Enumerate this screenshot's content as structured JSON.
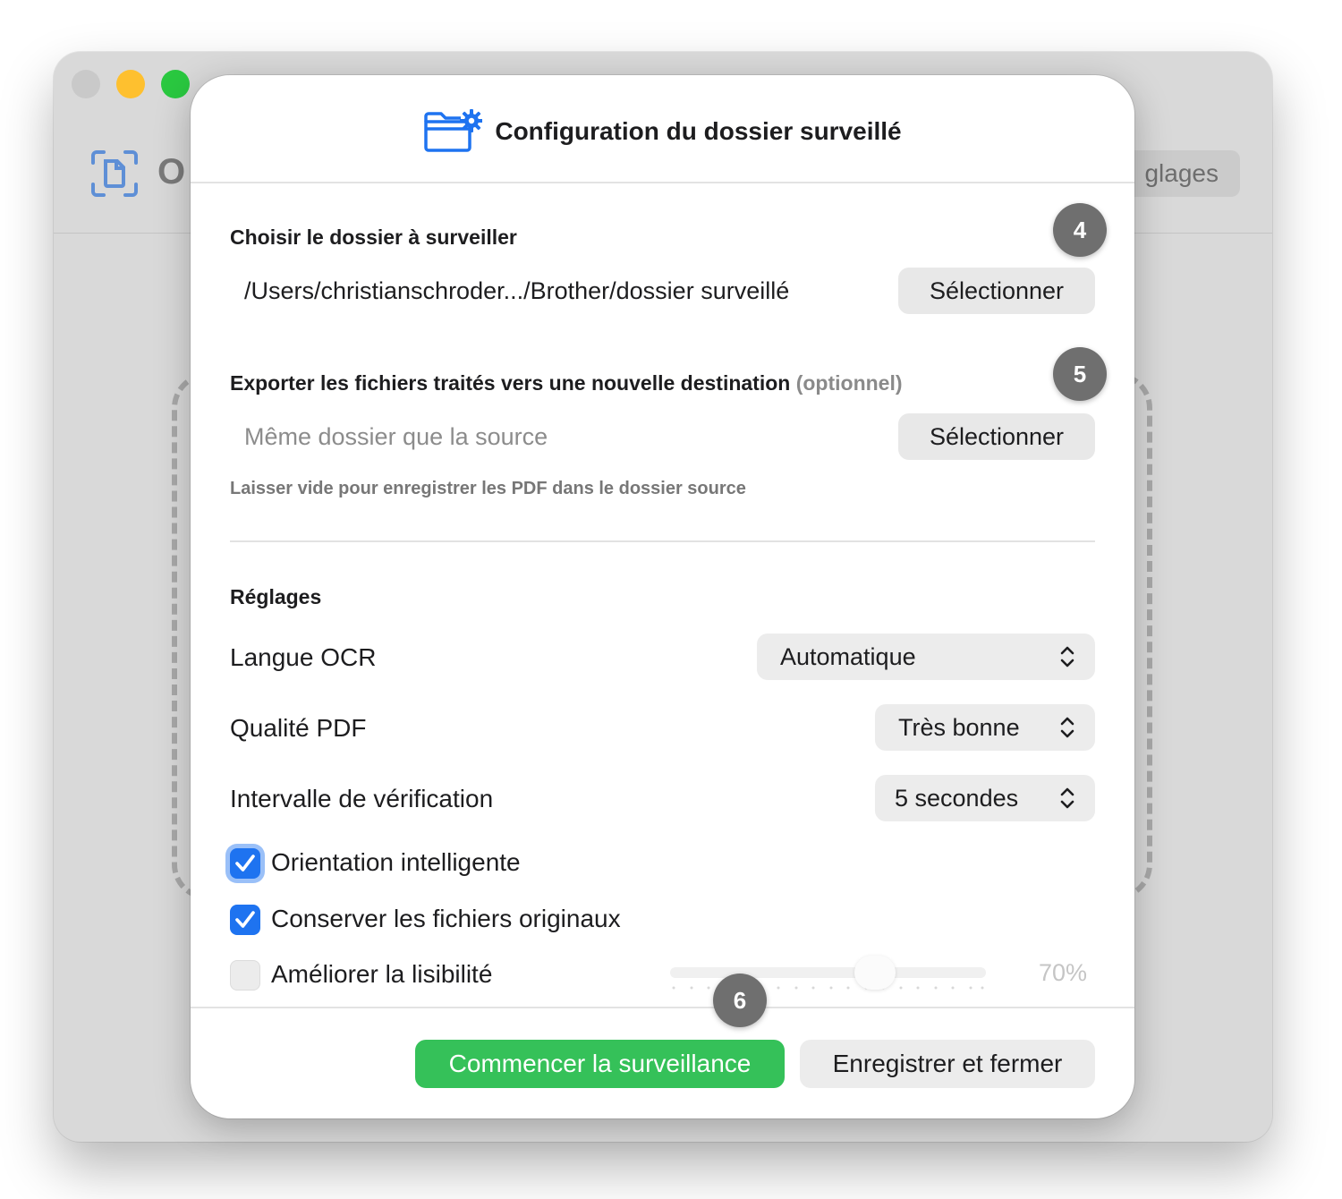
{
  "app": {
    "title_partial": "O",
    "settings_label_partial": "glages"
  },
  "sheet": {
    "title": "Configuration du dossier surveillé",
    "header_icon": "folder-gear-icon"
  },
  "source": {
    "label": "Choisir le dossier à surveiller",
    "path": "/Users/christianschroder.../Brother/dossier surveillé",
    "select_label": "Sélectionner",
    "badge": "4"
  },
  "export": {
    "label": "Exporter les fichiers traités vers une nouvelle destination",
    "optional": "(optionnel)",
    "placeholder": "Même dossier que la source",
    "select_label": "Sélectionner",
    "helper": "Laisser vide pour enregistrer les PDF dans le dossier source",
    "badge": "5"
  },
  "settings": {
    "heading": "Réglages",
    "ocr_language": {
      "label": "Langue OCR",
      "value": "Automatique"
    },
    "pdf_quality": {
      "label": "Qualité PDF",
      "value": "Très bonne"
    },
    "check_interval": {
      "label": "Intervalle de vérification",
      "value": "5 secondes"
    },
    "smart_orientation": {
      "label": "Orientation intelligente",
      "checked": true
    },
    "keep_originals": {
      "label": "Conserver les fichiers originaux",
      "checked": true
    },
    "improve_readability": {
      "label": "Améliorer la lisibilité",
      "checked": false,
      "slider_value": "70%",
      "slider_fraction": 0.7
    }
  },
  "footer": {
    "start_label": "Commencer la surveillance",
    "save_label": "Enregistrer et fermer",
    "badge": "6"
  },
  "colors": {
    "accent_blue": "#1e73f0",
    "green": "#35c159",
    "badge_gray": "#6f6f6f"
  }
}
